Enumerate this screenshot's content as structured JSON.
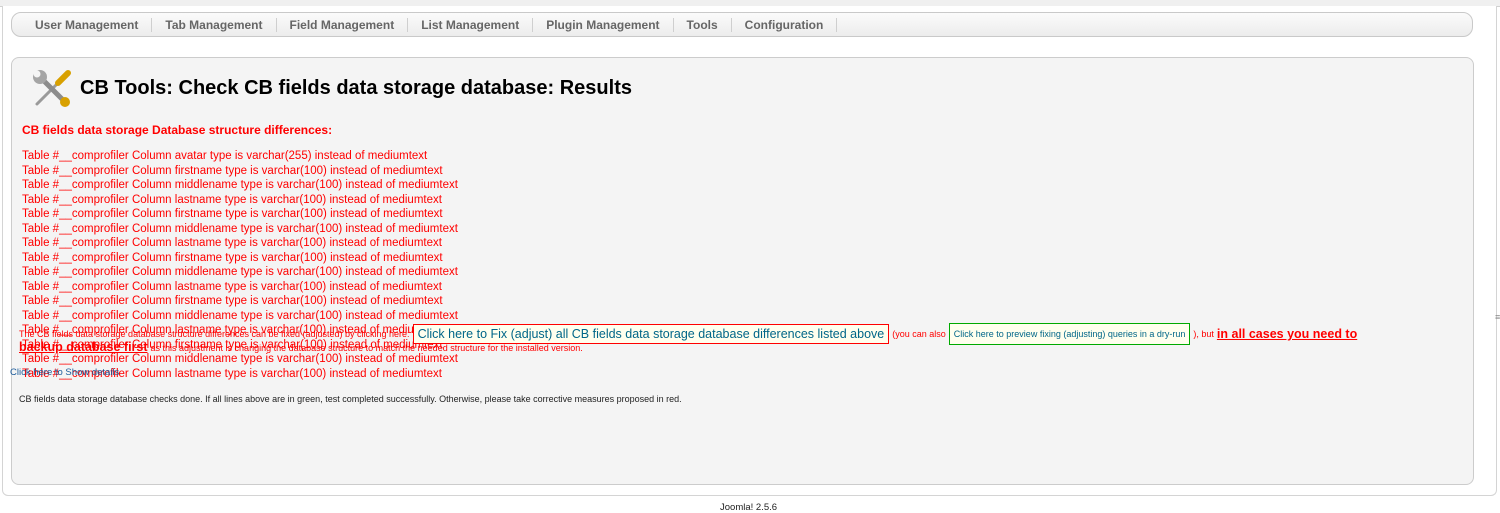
{
  "menu": {
    "items": [
      {
        "label": "User Management"
      },
      {
        "label": "Tab Management"
      },
      {
        "label": "Field Management"
      },
      {
        "label": "List Management"
      },
      {
        "label": "Plugin Management"
      },
      {
        "label": "Tools"
      },
      {
        "label": "Configuration"
      }
    ]
  },
  "page": {
    "title": "CB Tools: Check CB fields data storage database: Results",
    "icon": "tools-icon"
  },
  "differences": {
    "heading": "CB fields data storage Database structure differences:",
    "lines": [
      "Table #__comprofiler Column avatar type is varchar(255) instead of mediumtext",
      "Table #__comprofiler Column firstname type is varchar(100) instead of mediumtext",
      "Table #__comprofiler Column middlename type is varchar(100) instead of mediumtext",
      "Table #__comprofiler Column lastname type is varchar(100) instead of mediumtext",
      "Table #__comprofiler Column firstname type is varchar(100) instead of mediumtext",
      "Table #__comprofiler Column middlename type is varchar(100) instead of mediumtext",
      "Table #__comprofiler Column lastname type is varchar(100) instead of mediumtext",
      "Table #__comprofiler Column firstname type is varchar(100) instead of mediumtext",
      "Table #__comprofiler Column middlename type is varchar(100) instead of mediumtext",
      "Table #__comprofiler Column lastname type is varchar(100) instead of mediumtext",
      "Table #__comprofiler Column firstname type is varchar(100) instead of mediumtext",
      "Table #__comprofiler Column middlename type is varchar(100) instead of mediumtext",
      "Table #__comprofiler Column lastname type is varchar(100) instead of mediumtext",
      "Table #__comprofiler Column firstname type is varchar(100) instead of mediumtext",
      "Table #__comprofiler Column middlename type is varchar(100) instead of mediumtext",
      "Table #__comprofiler Column lastname type is varchar(100) instead of mediumtext"
    ]
  },
  "fix": {
    "intro": "The CB fields data storage database structure differences can be fixed (adjusted) by clicking here:",
    "fix_button": "Click here to Fix (adjust) all CB fields data storage database differences listed above",
    "also_text": "(you can also",
    "dry_run_button": "Click here to preview fixing (adjusting) queries in a dry-run",
    "but_text": "), but",
    "warning_part1": "in all cases you need to",
    "warning_part2": "backup database first",
    "after_warning": "as this adjustment is changing the database structure to match the needed structure for the installed version."
  },
  "details_link": "Click here to Show details",
  "status": "CB fields data storage database checks done. If all lines above are in green, test completed successfully. Otherwise, please take corrective measures proposed in red.",
  "footer": "Joomla! 2.5.6",
  "colors": {
    "error_text": "#ff0000",
    "link": "#1a5a9a",
    "panel_bg": "#f4f4f4"
  }
}
